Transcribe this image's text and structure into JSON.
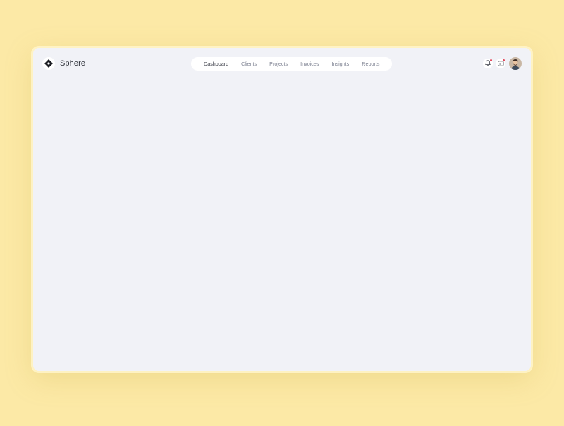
{
  "app": {
    "name": "Sphere"
  },
  "nav": {
    "items": [
      {
        "label": "Dashboard",
        "active": true
      },
      {
        "label": "Clients",
        "active": false
      },
      {
        "label": "Projects",
        "active": false
      },
      {
        "label": "Invoices",
        "active": false
      },
      {
        "label": "Insights",
        "active": false
      },
      {
        "label": "Reports",
        "active": false
      }
    ]
  },
  "actions": {
    "icons": [
      "bell-icon",
      "message-icon",
      "avatar"
    ]
  },
  "colors": {
    "background": "#fce9a6",
    "window": "#f1f2f7",
    "accent": "#e2465a",
    "text": "#2b2e36",
    "muted": "#7c8090"
  }
}
